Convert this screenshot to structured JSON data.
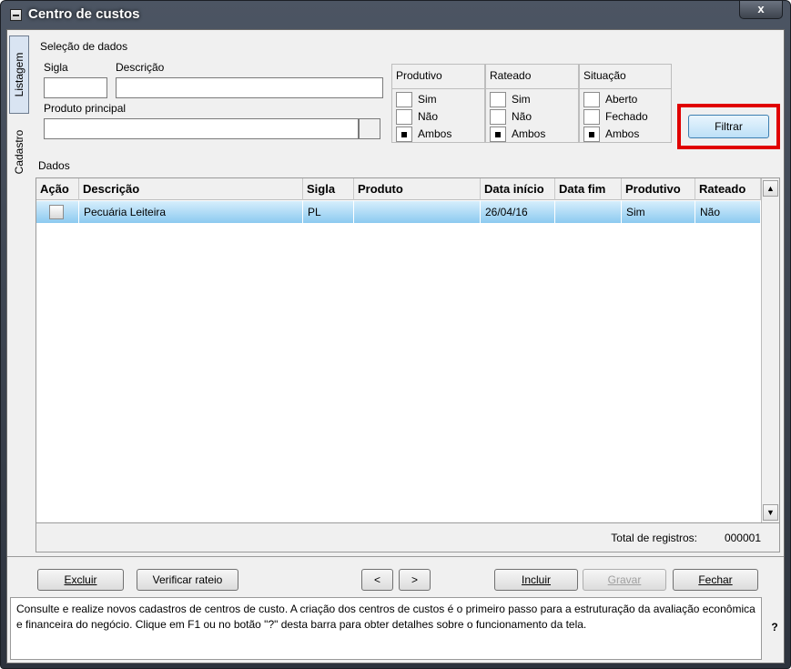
{
  "window": {
    "title": "Centro de custos",
    "close_label": "x"
  },
  "tabs": [
    {
      "label": "Listagem"
    },
    {
      "label": "Cadastro"
    }
  ],
  "selection": {
    "section_label": "Seleção de dados",
    "sigla_label": "Sigla",
    "sigla_value": "",
    "descricao_label": "Descrição",
    "descricao_value": "",
    "produto_label": "Produto principal",
    "produto_value": ""
  },
  "groups": {
    "produtivo": {
      "title": "Produtivo",
      "options": [
        "Sim",
        "Não",
        "Ambos"
      ],
      "selected": "Ambos"
    },
    "rateado": {
      "title": "Rateado",
      "options": [
        "Sim",
        "Não",
        "Ambos"
      ],
      "selected": "Ambos"
    },
    "situacao": {
      "title": "Situação",
      "options": [
        "Aberto",
        "Fechado",
        "Ambos"
      ],
      "selected": "Ambos"
    }
  },
  "filter_button": "Filtrar",
  "data_section_label": "Dados",
  "table": {
    "columns": [
      "Ação",
      "Descrição",
      "Sigla",
      "Produto",
      "Data início",
      "Data fim",
      "Produtivo",
      "Rateado"
    ],
    "rows": [
      {
        "acao": "",
        "descricao": "Pecuária Leiteira",
        "sigla": "PL",
        "produto": "",
        "data_inicio": "26/04/16",
        "data_fim": "",
        "produtivo": "Sim",
        "rateado": "Não"
      }
    ]
  },
  "total": {
    "label": "Total de registros:",
    "value": "000001"
  },
  "buttons": {
    "excluir": "Excluir",
    "verificar": "Verificar rateio",
    "prev": "<",
    "next": ">",
    "incluir": "Incluir",
    "gravar": "Gravar",
    "fechar": "Fechar"
  },
  "help": {
    "text": "Consulte e realize novos cadastros de centros de custo. A criação dos centros de custos é o primeiro passo para a estruturação da avaliação econômica e financeira do negócio. Clique em F1 ou no botão \"?\" desta barra para obter detalhes sobre o funcionamento da tela.",
    "button": "?"
  },
  "colors": {
    "highlight": "#e00000",
    "row_selected": "#8ccaf0"
  }
}
